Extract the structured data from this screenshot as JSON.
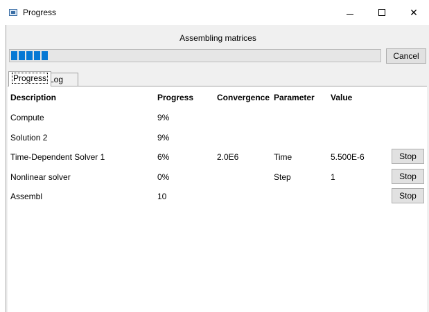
{
  "window": {
    "title": "Progress",
    "minimize_glyph": "—",
    "maximize_glyph": "☐",
    "close_glyph": "✕"
  },
  "status": {
    "message": "Assembling matrices",
    "progress_percent": 9,
    "progress_segments": 5,
    "fill_color": "#0678d4"
  },
  "buttons": {
    "cancel_label": "Cancel",
    "stop_label": "Stop"
  },
  "tabs": [
    {
      "label": "Progress",
      "selected": true
    },
    {
      "label": "Log",
      "selected": false
    }
  ],
  "table": {
    "headers": {
      "description": "Description",
      "progress": "Progress",
      "convergence": "Convergence",
      "parameter": "Parameter",
      "value": "Value"
    },
    "rows": [
      {
        "description": "Compute",
        "progress": "9%",
        "convergence": "",
        "parameter": "",
        "value": "",
        "stop": false
      },
      {
        "description": "Solution 2",
        "progress": "9%",
        "convergence": "",
        "parameter": "",
        "value": "",
        "stop": false
      },
      {
        "description": "Time-Dependent Solver 1",
        "progress": "6%",
        "convergence": "2.0E6",
        "parameter": "Time",
        "value": "5.500E-6",
        "stop": true
      },
      {
        "description": "Nonlinear solver",
        "progress": "0%",
        "convergence": "",
        "parameter": "Step",
        "value": "1",
        "stop": true
      },
      {
        "description": "Assembl",
        "progress": "10",
        "convergence": "",
        "parameter": "",
        "value": "",
        "stop": true
      }
    ]
  }
}
